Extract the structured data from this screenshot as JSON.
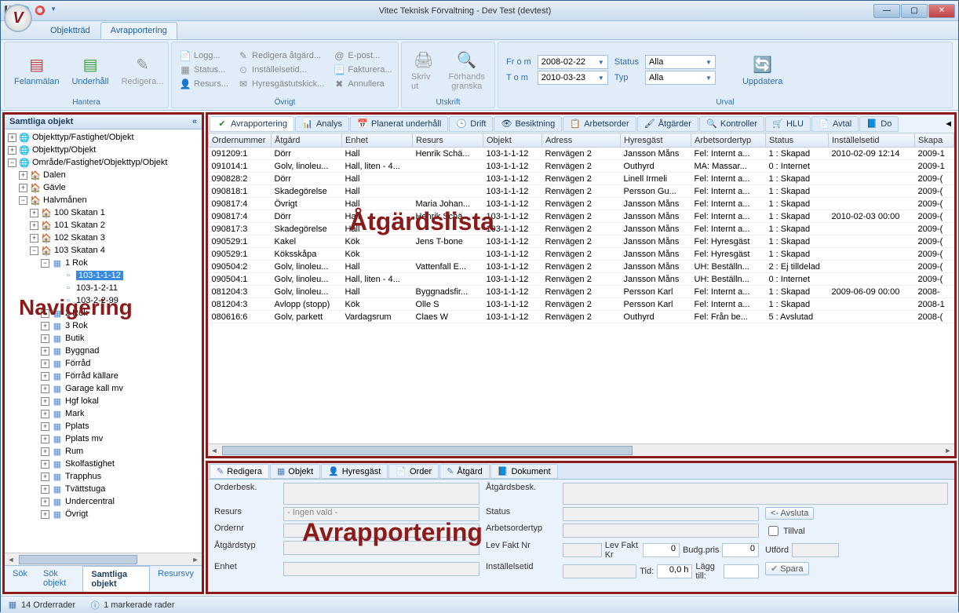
{
  "window": {
    "title": "Vitec Teknisk Förvaltning - Dev Test (devtest)"
  },
  "menu": {
    "tabs": [
      {
        "label": "Objektträd",
        "active": false
      },
      {
        "label": "Avrapportering",
        "active": true
      }
    ]
  },
  "ribbon": {
    "hantera": {
      "label": "Hantera",
      "felanmalan": "Felanmälan",
      "underhall": "Underhåll",
      "redigera": "Redigera..."
    },
    "ovrigt": {
      "label": "Övrigt",
      "logg": "Logg...",
      "status": "Status...",
      "resurs": "Resurs...",
      "redigera_atgard": "Redigera åtgärd...",
      "installsetid": "Inställelsetid...",
      "hyresgastutskick": "Hyresgästutskick...",
      "epost": "E-post...",
      "fakturera": "Fakturera...",
      "annullera": "Annullera"
    },
    "utskrift": {
      "label": "Utskrift",
      "skrivut": "Skriv ut",
      "forhands": "Förhands\ngranska"
    },
    "urval": {
      "label": "Urval",
      "from_label": "Fr o m",
      "from_value": "2008-02-22",
      "tom_label": "T o m",
      "tom_value": "2010-03-23",
      "status_label": "Status",
      "status_value": "Alla",
      "typ_label": "Typ",
      "typ_value": "Alla",
      "uppdatera": "Uppdatera"
    }
  },
  "left": {
    "header": "Samtliga objekt",
    "roots": [
      "Objekttyp/Fastighet/Objekt",
      "Objekttyp/Objekt",
      "Område/Fastighet/Objekttyp/Objekt"
    ],
    "areas": [
      "Dalen",
      "Gävle",
      "Halvmånen"
    ],
    "skatan": [
      "100 Skatan 1",
      "101 Skatan 2",
      "102 Skatan 3",
      "103 Skatan 4"
    ],
    "rok1": "1 Rok",
    "leaves": [
      "103-1-1-12",
      "103-1-2-11",
      "103-2-2-99"
    ],
    "after": [
      "2 Rok",
      "3 Rok",
      "Butik",
      "Byggnad",
      "Förråd",
      "Förråd källare",
      "Garage kall mv",
      "Hgf lokal",
      "Mark",
      "Pplats",
      "Pplats mv",
      "Rum",
      "Skolfastighet",
      "Trapphus",
      "Tvättstuga",
      "Undercentral",
      "Övrigt"
    ],
    "tabs": [
      "Sök",
      "Sök objekt",
      "Samtliga objekt",
      "Resursvy"
    ],
    "active_tab": 2,
    "overlay": "Navigering"
  },
  "viewtabs": [
    {
      "label": "Avrapportering",
      "icon": "✔",
      "color": "#2a8a2a",
      "active": true
    },
    {
      "label": "Analys",
      "icon": "📊",
      "active": false
    },
    {
      "label": "Planerat underhåll",
      "icon": "📅",
      "active": false
    },
    {
      "label": "Drift",
      "icon": "🕒",
      "active": false
    },
    {
      "label": "Besiktning",
      "icon": "👁",
      "active": false
    },
    {
      "label": "Arbetsorder",
      "icon": "📋",
      "active": false
    },
    {
      "label": "Åtgärder",
      "icon": "🖌",
      "active": false
    },
    {
      "label": "Kontroller",
      "icon": "🔍",
      "active": false
    },
    {
      "label": "HLU",
      "icon": "🛒",
      "active": false
    },
    {
      "label": "Avtal",
      "icon": "📄",
      "active": false
    },
    {
      "label": "Do",
      "icon": "📘",
      "active": false
    }
  ],
  "grid": {
    "overlay": "Åtgärdslista",
    "columns": [
      "Ordernummer",
      "Åtgärd",
      "Enhet",
      "Resurs",
      "Objekt",
      "Adress",
      "Hyresgäst",
      "Arbetsordertyp",
      "Status",
      "Inställelsetid",
      "Skapa"
    ],
    "rows": [
      [
        "091209:1",
        "Dörr",
        "Hall",
        "Henrik Schä...",
        "103-1-1-12",
        "Renvägen 2",
        "Jansson Måns",
        "Fel: Internt a...",
        "1 : Skapad",
        "2010-02-09 12:14",
        "2009-1"
      ],
      [
        "091014:1",
        "Golv, linoleu...",
        "Hall, liten - 4...",
        "",
        "103-1-1-12",
        "Renvägen 2",
        "Outhyrd",
        "MA: Massar...",
        "0 : Internet",
        "",
        "2009-1"
      ],
      [
        "090828:2",
        "Dörr",
        "Hall",
        "",
        "103-1-1-12",
        "Renvägen 2",
        "Linell Irmeli",
        "Fel: Internt a...",
        "1 : Skapad",
        "",
        "2009-("
      ],
      [
        "090818:1",
        "Skadegörelse",
        "Hall",
        "",
        "103-1-1-12",
        "Renvägen 2",
        "Persson Gu...",
        "Fel: Internt a...",
        "1 : Skapad",
        "",
        "2009-("
      ],
      [
        "090817:4",
        "Övrigt",
        "Hall",
        "Maria Johan...",
        "103-1-1-12",
        "Renvägen 2",
        "Jansson Måns",
        "Fel: Internt a...",
        "1 : Skapad",
        "",
        "2009-("
      ],
      [
        "090817:4",
        "Dörr",
        "Hall",
        "Henrik Schä...",
        "103-1-1-12",
        "Renvägen 2",
        "Jansson Måns",
        "Fel: Internt a...",
        "1 : Skapad",
        "2010-02-03 00:00",
        "2009-("
      ],
      [
        "090817:3",
        "Skadegörelse",
        "Hall",
        "",
        "103-1-1-12",
        "Renvägen 2",
        "Jansson Måns",
        "Fel: Internt a...",
        "1 : Skapad",
        "",
        "2009-("
      ],
      [
        "090529:1",
        "Kakel",
        "Kök",
        "Jens T-bone",
        "103-1-1-12",
        "Renvägen 2",
        "Jansson Måns",
        "Fel: Hyresgäst",
        "1 : Skapad",
        "",
        "2009-("
      ],
      [
        "090529:1",
        "Köksskåpa",
        "Kök",
        "",
        "103-1-1-12",
        "Renvägen 2",
        "Jansson Måns",
        "Fel: Hyresgäst",
        "1 : Skapad",
        "",
        "2009-("
      ],
      [
        "090504:2",
        "Golv, linoleu...",
        "Hall",
        "Vattenfall E...",
        "103-1-1-12",
        "Renvägen 2",
        "Jansson Måns",
        "UH: Beställn...",
        "2 : Ej tilldelad",
        "",
        "2009-("
      ],
      [
        "090504:1",
        "Golv, linoleu...",
        "Hall, liten - 4...",
        "",
        "103-1-1-12",
        "Renvägen 2",
        "Jansson Måns",
        "UH: Beställn...",
        "0 : Internet",
        "",
        "2009-("
      ],
      [
        "081204:3",
        "Golv, linoleu...",
        "Hall",
        "Byggnadsfir...",
        "103-1-1-12",
        "Renvägen 2",
        "Persson Karl",
        "Fel: Internt a...",
        "1 : Skapad",
        "2009-06-09 00:00",
        "2008-"
      ],
      [
        "081204:3",
        "Avlopp (stopp)",
        "Kök",
        "Olle S",
        "103-1-1-12",
        "Renvägen 2",
        "Persson Karl",
        "Fel: Internt a...",
        "1 : Skapad",
        "",
        "2008-1"
      ],
      [
        "080616:6",
        "Golv, parkett",
        "Vardagsrum",
        "Claes W",
        "103-1-1-12",
        "Renvägen 2",
        "Outhyrd",
        "Fel: Från be...",
        "5 : Avslutad",
        "",
        "2008-("
      ]
    ]
  },
  "detail": {
    "overlay": "Avrapportering",
    "tabs": [
      "Redigera",
      "Objekt",
      "Hyresgäst",
      "Order",
      "Åtgärd",
      "Dokument"
    ],
    "tab_icons": [
      "✎",
      "▦",
      "👤",
      "📄",
      "✎",
      "📘"
    ],
    "labels": {
      "orderbesk": "Orderbesk.",
      "resurs": "Resurs",
      "ordernr": "Ordernr",
      "atgardstyp": "Åtgärdstyp",
      "enhet": "Enhet",
      "atgardsbesk": "Åtgärdsbesk.",
      "status": "Status",
      "arbetsordertyp": "Arbetsordertyp",
      "levfaktnr": "Lev Fakt Nr",
      "levfaktkr": "Lev Fakt Kr",
      "budgpris": "Budg.pris",
      "utford": "Utförd",
      "installsetid": "Inställelsetid",
      "tid": "Tid:",
      "tid_value": "0,0 h",
      "laggtill": "Lägg till:",
      "zero": "0",
      "resurs_placeholder": "- Ingen vald -",
      "avsluta": "<- Avsluta",
      "tillval": "Tillval",
      "spara": "Spara"
    }
  },
  "status": {
    "orders": "14 Orderrader",
    "selected": "1 markerade rader"
  }
}
